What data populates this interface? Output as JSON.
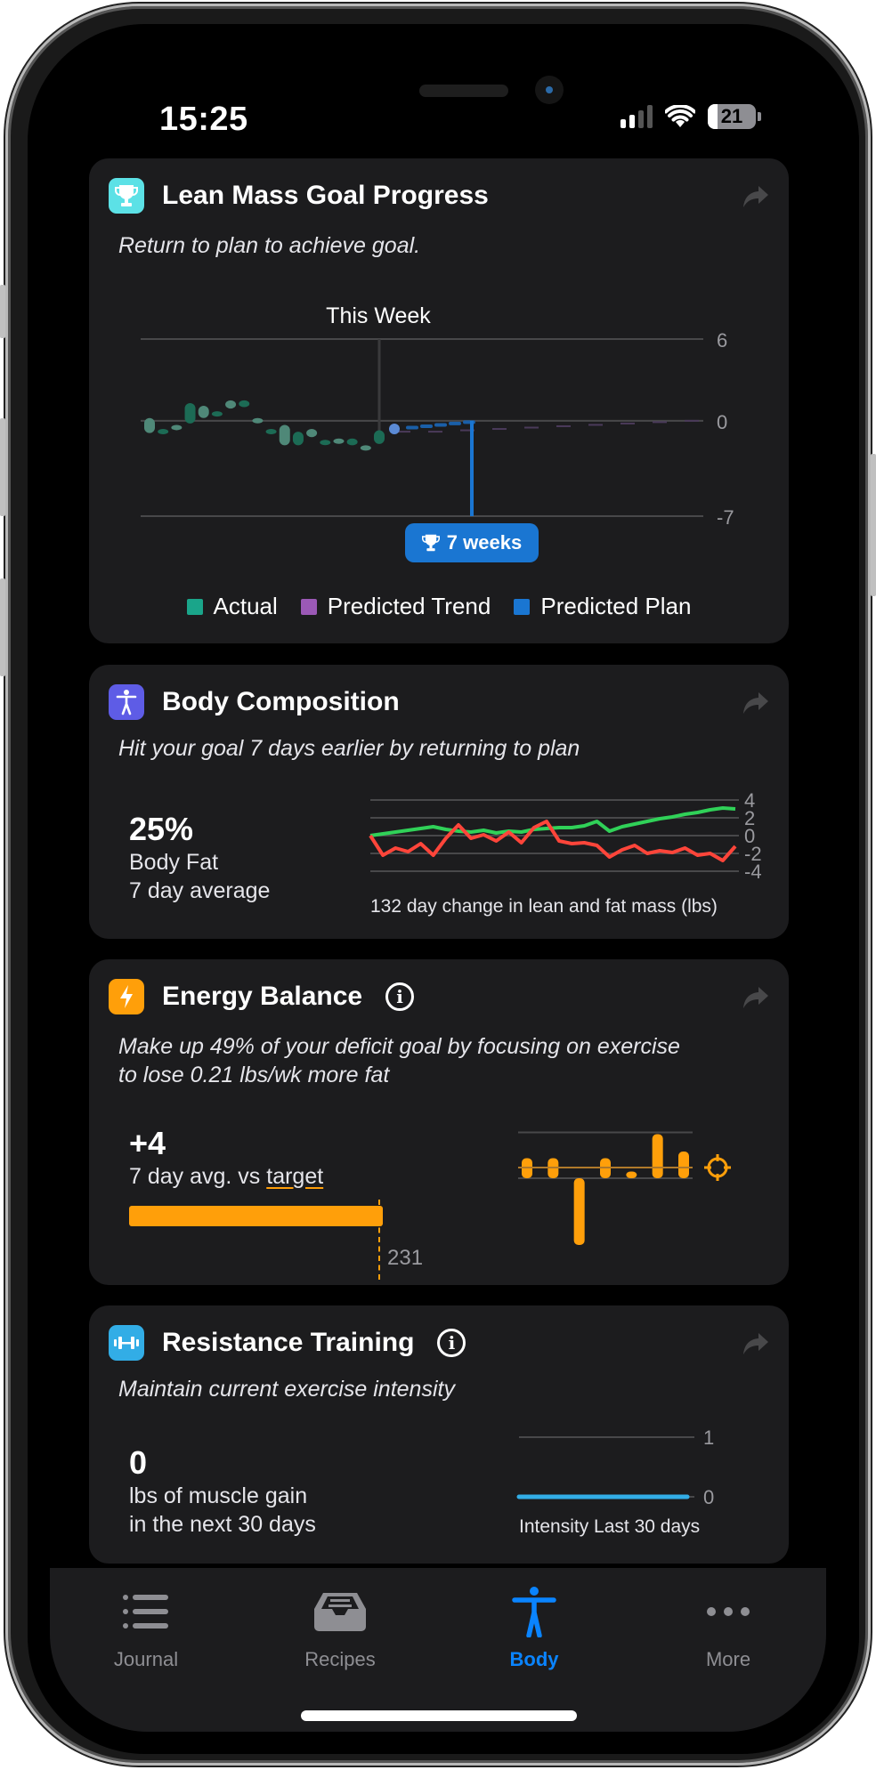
{
  "status_bar": {
    "time": "15:25",
    "battery_level": "21",
    "battery_fraction": 0.21,
    "signal_bars_active": 2,
    "signal_bars_total": 4
  },
  "cards": {
    "lean_mass": {
      "title": "Lean Mass Goal Progress",
      "icon": "trophy-icon",
      "icon_color": "#5ce1e6",
      "subtitle": "Return to plan to achieve goal.",
      "badge": "7 weeks",
      "marker_label": "This Week",
      "legend": [
        {
          "label": "Actual",
          "color": "#1aa58a"
        },
        {
          "label": "Predicted Trend",
          "color": "#9b59b6"
        },
        {
          "label": "Predicted Plan",
          "color": "#1a76d2"
        }
      ]
    },
    "body_comp": {
      "title": "Body Composition",
      "icon": "figure-icon",
      "icon_color": "#5e5ce6",
      "subtitle": "Hit your goal 7 days earlier by returning to plan",
      "value": "25%",
      "value_label_1": "Body Fat",
      "value_label_2": "7 day average",
      "caption": "132 day change in lean and fat mass (lbs)"
    },
    "energy": {
      "title": "Energy Balance",
      "icon": "bolt-icon",
      "icon_color": "#ff9f0a",
      "subtitle_1": "Make up 49% of your deficit goal by focusing on exercise",
      "subtitle_2": "to lose 0.21 lbs/wk more fat",
      "value": "+4",
      "value_label_prefix": "7 day avg. vs ",
      "value_label_link": "target",
      "target_value": "231"
    },
    "resistance": {
      "title": "Resistance Training",
      "icon": "dumbbell-icon",
      "icon_color": "#32ade6",
      "subtitle": "Maintain current exercise intensity",
      "value": "0",
      "value_label_1": "lbs of muscle gain",
      "value_label_2": "in the next 30 days",
      "caption": "Intensity Last 30 days"
    }
  },
  "tab_bar": {
    "tabs": [
      {
        "label": "Journal",
        "icon": "list-icon",
        "active": false
      },
      {
        "label": "Recipes",
        "icon": "tray-icon",
        "active": false
      },
      {
        "label": "Body",
        "icon": "figure-icon",
        "active": true
      },
      {
        "label": "More",
        "icon": "ellipsis-icon",
        "active": false
      }
    ]
  },
  "chart_data": [
    {
      "type": "bar",
      "title": "Lean Mass Goal Progress",
      "ylim": [
        -7,
        6
      ],
      "yticks": [
        "6",
        "0",
        "-7"
      ],
      "marker": "This Week",
      "series": [
        {
          "name": "Actual",
          "ranges": [
            [
              -0.9,
              0.2
            ],
            [
              -0.7,
              -0.6
            ],
            [
              -0.5,
              -0.3
            ],
            [
              -0.2,
              1.3
            ],
            [
              0.2,
              1.1
            ],
            [
              0.4,
              0.7
            ],
            [
              0.9,
              1.5
            ],
            [
              1.0,
              1.5
            ],
            [
              -0.1,
              0.2
            ],
            [
              -0.7,
              -0.6
            ],
            [
              -1.8,
              -0.3
            ],
            [
              -1.8,
              -0.8
            ],
            [
              -1.2,
              -0.6
            ],
            [
              -1.6,
              -1.4
            ],
            [
              -1.6,
              -1.3
            ],
            [
              -1.8,
              -1.3
            ],
            [
              -1.9,
              -1.8
            ],
            [
              -1.7,
              -0.7
            ]
          ]
        },
        {
          "name": "Predicted Plan",
          "values": [
            -0.6,
            -0.5,
            -0.4,
            -0.3,
            -0.2,
            -0.1,
            0.0
          ],
          "goal_drop": -7
        },
        {
          "name": "Predicted Trend",
          "values": [
            -0.8,
            -0.8,
            -0.7,
            -0.6,
            -0.5,
            -0.4,
            -0.3,
            -0.2,
            -0.1,
            0.0
          ]
        }
      ]
    },
    {
      "type": "line",
      "caption": "132 day change in lean and fat mass (lbs)",
      "ylim": [
        -4,
        4
      ],
      "yticks": [
        "4",
        "2",
        "0",
        "-2",
        "-4"
      ],
      "series": [
        {
          "name": "Lean mass",
          "color": "#30d158",
          "values": [
            0,
            0.2,
            0.4,
            0.6,
            0.8,
            1.0,
            0.7,
            0.5,
            0.4,
            0.6,
            0.3,
            0.5,
            0.4,
            0.7,
            0.8,
            0.9,
            0.9,
            1.1,
            1.6,
            0.5,
            1.0,
            1.3,
            1.6,
            1.9,
            2.1,
            2.4,
            2.6,
            2.9,
            3.1,
            3.0
          ]
        },
        {
          "name": "Fat mass",
          "color": "#ff453a",
          "values": [
            0,
            -2.2,
            -1.4,
            -1.8,
            -0.9,
            -2.2,
            -0.3,
            1.2,
            -0.3,
            0.1,
            -0.6,
            0.4,
            -0.8,
            0.9,
            1.6,
            -0.6,
            -0.9,
            -0.8,
            -1.1,
            -2.4,
            -1.6,
            -1.1,
            -2.0,
            -1.7,
            -1.9,
            -1.4,
            -2.2,
            -2.0,
            -2.8,
            -1.2
          ]
        }
      ]
    },
    {
      "type": "bar",
      "title": "Energy Balance 7 day",
      "values": [
        1.5,
        1.5,
        -5.0,
        1.5,
        0.5,
        3.3,
        2.0
      ],
      "target_line": 0.8
    },
    {
      "type": "line",
      "caption": "Intensity Last 30 days",
      "ylim": [
        0,
        1
      ],
      "yticks": [
        "1",
        "0"
      ],
      "series": [
        {
          "name": "Intensity",
          "color": "#32ade6",
          "values": [
            0,
            0
          ]
        }
      ]
    }
  ]
}
